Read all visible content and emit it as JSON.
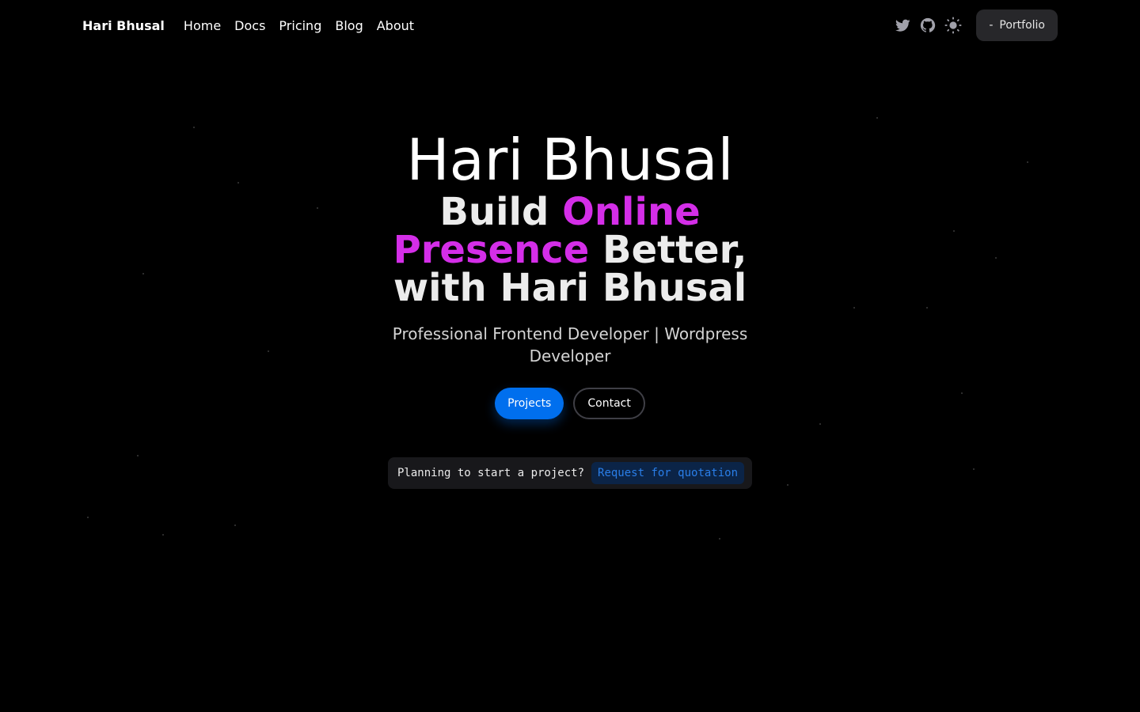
{
  "nav": {
    "brand": "Hari Bhusal",
    "links": [
      "Home",
      "Docs",
      "Pricing",
      "Blog",
      "About"
    ],
    "icons": [
      "twitter-icon",
      "github-icon",
      "sun-icon"
    ],
    "portfolio_label": "Portfolio",
    "portfolio_prefix": "-"
  },
  "hero": {
    "name": "Hari Bhusal",
    "headline_part1": "Build ",
    "headline_accent": "Online Presence",
    "headline_part2": " Better, with Hari Bhusal",
    "subtitle": "Professional Frontend Developer | Wordpress Developer",
    "primary_button": "Projects",
    "secondary_button": "Contact"
  },
  "quote": {
    "text": "Planning to start a project?",
    "link": "Request for quotation"
  },
  "colors": {
    "background": "#000000",
    "accent": "#d42ee8",
    "primary": "#006fee"
  }
}
